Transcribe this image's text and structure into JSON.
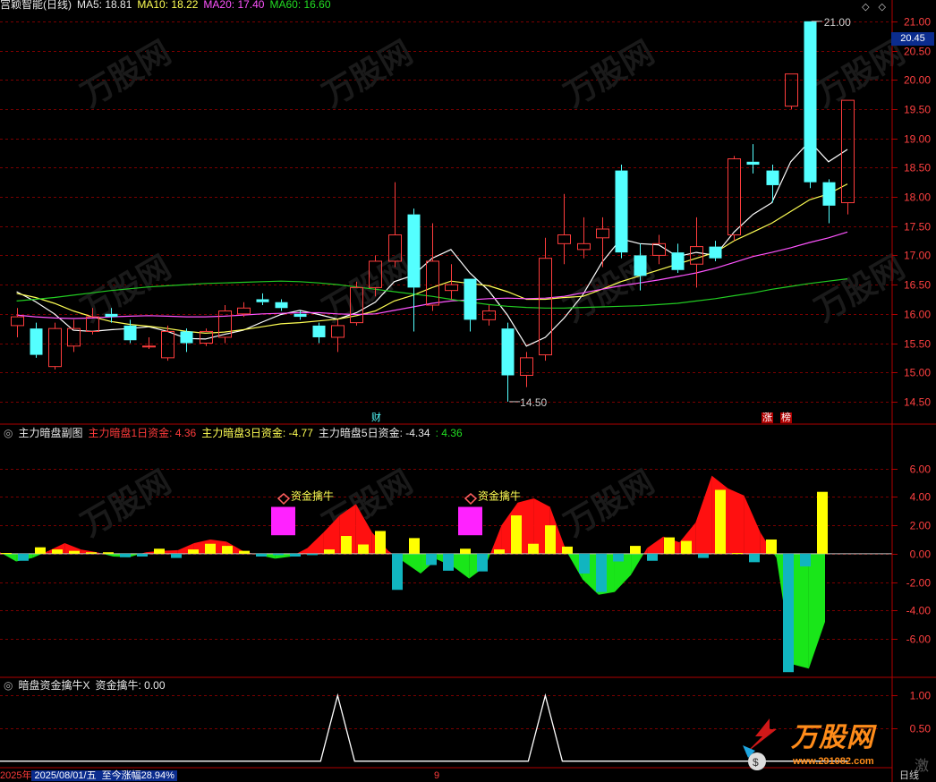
{
  "header": {
    "title": "宫颖智能(日线)",
    "ma5": "MA5: 18.81",
    "ma10": "MA10: 18.22",
    "ma20": "MA20: 17.40",
    "ma60": "MA60: 16.60"
  },
  "sub_header": {
    "name": "主力暗盘副图",
    "s1": "主力暗盘1日资金: 4.36",
    "s3": "主力暗盘3日资金: -4.77",
    "s5": "主力暗盘5日资金: -4.34",
    "extra": ": 4.36"
  },
  "sub2_header": {
    "name": "暗盘资金擒牛X",
    "value": "资金擒牛: 0.00"
  },
  "current_price": "20.45",
  "markers": {
    "cai": "财",
    "zhang": "涨",
    "bang": "榜"
  },
  "status": {
    "year": "2025年",
    "date": "2025/08/01/五",
    "gain": "至今涨幅28.94%",
    "tick": "9"
  },
  "side_label": "日线",
  "watermark": "激",
  "logo": {
    "text": "万股网",
    "url": "www.291082.com"
  },
  "colors": {
    "up": "#ff3d3d",
    "down": "#54ffff",
    "ma5": "#ffffff",
    "ma10": "#ffff54",
    "ma20": "#ff54ff",
    "ma60": "#22cc22",
    "grid": "#7a0000",
    "axis": "#b00000"
  },
  "chart_data": [
    {
      "type": "candlestick",
      "title": "宫颖智能(日线)",
      "y_ticks": [
        "21.00",
        "20.50",
        "20.00",
        "19.50",
        "19.00",
        "18.50",
        "18.00",
        "17.50",
        "17.00",
        "16.50",
        "16.00",
        "15.50",
        "15.00",
        "14.50"
      ],
      "ylim": [
        14.3,
        21.15
      ],
      "high_label": "21.00",
      "low_label": "14.50",
      "candles": [
        {
          "o": 15.8,
          "c": 15.95,
          "h": 16.1,
          "l": 15.6
        },
        {
          "o": 15.75,
          "c": 15.3,
          "h": 15.85,
          "l": 15.25
        },
        {
          "o": 15.1,
          "c": 15.75,
          "h": 15.85,
          "l": 15.05
        },
        {
          "o": 15.45,
          "c": 15.75,
          "h": 15.9,
          "l": 15.35
        },
        {
          "o": 15.7,
          "c": 15.95,
          "h": 16.1,
          "l": 15.65
        },
        {
          "o": 16.0,
          "c": 15.95,
          "h": 16.1,
          "l": 15.85
        },
        {
          "o": 15.8,
          "c": 15.55,
          "h": 15.9,
          "l": 15.5
        },
        {
          "o": 15.45,
          "c": 15.45,
          "h": 15.6,
          "l": 15.4
        },
        {
          "o": 15.25,
          "c": 15.7,
          "h": 15.8,
          "l": 15.2
        },
        {
          "o": 15.7,
          "c": 15.5,
          "h": 15.75,
          "l": 15.35
        },
        {
          "o": 15.5,
          "c": 15.7,
          "h": 15.75,
          "l": 15.45
        },
        {
          "o": 15.6,
          "c": 16.05,
          "h": 16.15,
          "l": 15.5
        },
        {
          "o": 16.0,
          "c": 16.1,
          "h": 16.2,
          "l": 15.95
        },
        {
          "o": 16.25,
          "c": 16.2,
          "h": 16.35,
          "l": 16.15
        },
        {
          "o": 16.2,
          "c": 16.1,
          "h": 16.25,
          "l": 16.05
        },
        {
          "o": 16.0,
          "c": 15.95,
          "h": 16.05,
          "l": 15.9
        },
        {
          "o": 15.8,
          "c": 15.6,
          "h": 15.85,
          "l": 15.5
        },
        {
          "o": 15.6,
          "c": 15.8,
          "h": 15.9,
          "l": 15.35
        },
        {
          "o": 15.85,
          "c": 16.45,
          "h": 16.55,
          "l": 15.8
        },
        {
          "o": 16.45,
          "c": 16.9,
          "h": 17.0,
          "l": 16.3
        },
        {
          "o": 16.9,
          "c": 17.35,
          "h": 18.25,
          "l": 16.8
        },
        {
          "o": 17.7,
          "c": 16.45,
          "h": 17.8,
          "l": 15.7
        },
        {
          "o": 16.15,
          "c": 16.9,
          "h": 17.55,
          "l": 16.05
        },
        {
          "o": 16.4,
          "c": 16.5,
          "h": 16.85,
          "l": 16.25
        },
        {
          "o": 16.6,
          "c": 15.9,
          "h": 16.6,
          "l": 15.7
        },
        {
          "o": 15.9,
          "c": 16.05,
          "h": 16.15,
          "l": 15.8
        },
        {
          "o": 15.75,
          "c": 14.95,
          "h": 15.85,
          "l": 14.5
        },
        {
          "o": 14.95,
          "c": 15.25,
          "h": 15.35,
          "l": 14.75
        },
        {
          "o": 15.3,
          "c": 16.95,
          "h": 17.3,
          "l": 15.2
        },
        {
          "o": 17.2,
          "c": 17.35,
          "h": 18.05,
          "l": 16.85
        },
        {
          "o": 17.1,
          "c": 17.2,
          "h": 17.65,
          "l": 16.95
        },
        {
          "o": 17.3,
          "c": 17.45,
          "h": 17.65,
          "l": 16.8
        },
        {
          "o": 18.45,
          "c": 17.05,
          "h": 18.55,
          "l": 16.95
        },
        {
          "o": 17.0,
          "c": 16.65,
          "h": 17.2,
          "l": 16.4
        },
        {
          "o": 17.0,
          "c": 17.2,
          "h": 17.35,
          "l": 16.85
        },
        {
          "o": 17.05,
          "c": 16.75,
          "h": 17.2,
          "l": 16.7
        },
        {
          "o": 16.85,
          "c": 17.15,
          "h": 17.65,
          "l": 16.45
        },
        {
          "o": 17.15,
          "c": 16.95,
          "h": 17.25,
          "l": 16.9
        },
        {
          "o": 17.35,
          "c": 18.65,
          "h": 18.7,
          "l": 17.25
        },
        {
          "o": 18.6,
          "c": 18.55,
          "h": 18.9,
          "l": 18.4
        },
        {
          "o": 18.45,
          "c": 18.2,
          "h": 18.55,
          "l": 17.9
        },
        {
          "o": 19.55,
          "c": 20.1,
          "h": 20.1,
          "l": 19.5
        },
        {
          "o": 21.0,
          "c": 18.25,
          "h": 21.0,
          "l": 18.15
        },
        {
          "o": 18.25,
          "c": 17.85,
          "h": 18.3,
          "l": 17.55
        },
        {
          "o": 17.9,
          "c": 19.65,
          "h": 19.65,
          "l": 17.7
        }
      ],
      "ma5": [
        16.38,
        16.21,
        16.0,
        15.72,
        15.7,
        15.73,
        15.75,
        15.78,
        15.7,
        15.58,
        15.57,
        15.65,
        15.72,
        15.86,
        15.99,
        16.06,
        15.99,
        15.91,
        16.02,
        16.2,
        16.55,
        16.66,
        16.95,
        17.1,
        16.7,
        16.4,
        15.98,
        15.45,
        15.6,
        15.93,
        16.33,
        16.88,
        17.28,
        17.2,
        17.18,
        16.98,
        17.05,
        17.0,
        17.4,
        17.7,
        17.9,
        18.6,
        18.95,
        18.6,
        18.81
      ],
      "ma10": [
        16.35,
        16.28,
        16.18,
        16.05,
        15.95,
        15.87,
        15.82,
        15.79,
        15.75,
        15.7,
        15.67,
        15.69,
        15.73,
        15.78,
        15.83,
        15.85,
        15.88,
        15.91,
        15.97,
        16.05,
        16.22,
        16.32,
        16.45,
        16.56,
        16.52,
        16.48,
        16.38,
        16.25,
        16.25,
        16.28,
        16.3,
        16.42,
        16.55,
        16.65,
        16.75,
        16.85,
        16.95,
        17.05,
        17.25,
        17.4,
        17.55,
        17.75,
        17.95,
        18.05,
        18.22
      ],
      "ma20": [
        15.98,
        15.95,
        15.93,
        15.92,
        15.93,
        15.95,
        15.96,
        15.97,
        15.96,
        15.95,
        15.95,
        15.96,
        15.98,
        16.0,
        16.01,
        16.02,
        16.02,
        16.0,
        15.99,
        16.0,
        16.06,
        16.12,
        16.18,
        16.22,
        16.24,
        16.26,
        16.27,
        16.26,
        16.27,
        16.3,
        16.36,
        16.42,
        16.48,
        16.53,
        16.58,
        16.64,
        16.7,
        16.78,
        16.88,
        16.98,
        17.05,
        17.13,
        17.22,
        17.3,
        17.4
      ],
      "ma60": [
        16.22,
        16.25,
        16.28,
        16.32,
        16.36,
        16.4,
        16.43,
        16.46,
        16.48,
        16.5,
        16.52,
        16.53,
        16.54,
        16.55,
        16.56,
        16.55,
        16.53,
        16.5,
        16.46,
        16.42,
        16.38,
        16.34,
        16.3,
        16.25,
        16.2,
        16.16,
        16.13,
        16.11,
        16.1,
        16.1,
        16.11,
        16.12,
        16.13,
        16.14,
        16.16,
        16.18,
        16.22,
        16.26,
        16.31,
        16.36,
        16.42,
        16.47,
        16.52,
        16.56,
        16.6
      ]
    },
    {
      "type": "bar",
      "title": "主力暗盘副图",
      "y_ticks": [
        "6.00",
        "4.00",
        "2.00",
        "0.00",
        "-2.00",
        "-4.00",
        "-6.00"
      ],
      "ylim": [
        -8.4,
        8.0
      ],
      "signal_label": "资金擒牛",
      "area": [
        0.1,
        -0.55,
        -0.3,
        0.2,
        0.75,
        0.3,
        0.1,
        -0.2,
        -0.25,
        0.1,
        0.2,
        0.25,
        0.75,
        1.0,
        0.85,
        0.2,
        -0.1,
        -0.35,
        -0.2,
        0.4,
        1.5,
        2.7,
        3.5,
        1.5,
        0.2,
        -0.6,
        -1.4,
        -0.4,
        -0.9,
        -1.75,
        -0.9,
        2.0,
        3.6,
        3.9,
        3.3,
        0.2,
        -1.8,
        -2.9,
        -2.7,
        -1.5,
        0.4,
        1.2,
        0.8,
        2.2,
        5.5,
        4.6,
        4.1,
        1.5,
        -0.3,
        -7.8,
        -8.1,
        -4.8
      ],
      "bars": [
        0.05,
        -0.5,
        0.45,
        0.3,
        0.2,
        0.1,
        0.1,
        -0.25,
        -0.2,
        0.35,
        -0.3,
        0.3,
        0.7,
        0.55,
        0.2,
        -0.2,
        -0.1,
        -0.2,
        -0.1,
        0.3,
        1.25,
        0.65,
        1.6,
        -2.55,
        1.1,
        -0.8,
        -1.2,
        0.35,
        -1.25,
        0.3,
        2.7,
        0.7,
        2.0,
        0.5,
        -1.4,
        -2.7,
        -0.55,
        0.55,
        -0.5,
        1.15,
        0.9,
        -0.3,
        4.5,
        0.05,
        -0.6,
        1.0,
        -8.35,
        -0.9,
        4.36
      ],
      "signals": [
        16,
        27
      ]
    },
    {
      "type": "line",
      "title": "暗盘资金擒牛X",
      "y_ticks": [
        "1.00",
        "0.50"
      ],
      "ylim": [
        -0.1,
        1.1
      ],
      "values": [
        0,
        0,
        0,
        0,
        0,
        0,
        0,
        0,
        0,
        0,
        0,
        0,
        0,
        0,
        0,
        0,
        0,
        1,
        0,
        0,
        0,
        0,
        0,
        0,
        0,
        0,
        0,
        0,
        1,
        0,
        0,
        0,
        0,
        0,
        0,
        0,
        0,
        0,
        0,
        0,
        0,
        0,
        0,
        0,
        0
      ]
    }
  ]
}
